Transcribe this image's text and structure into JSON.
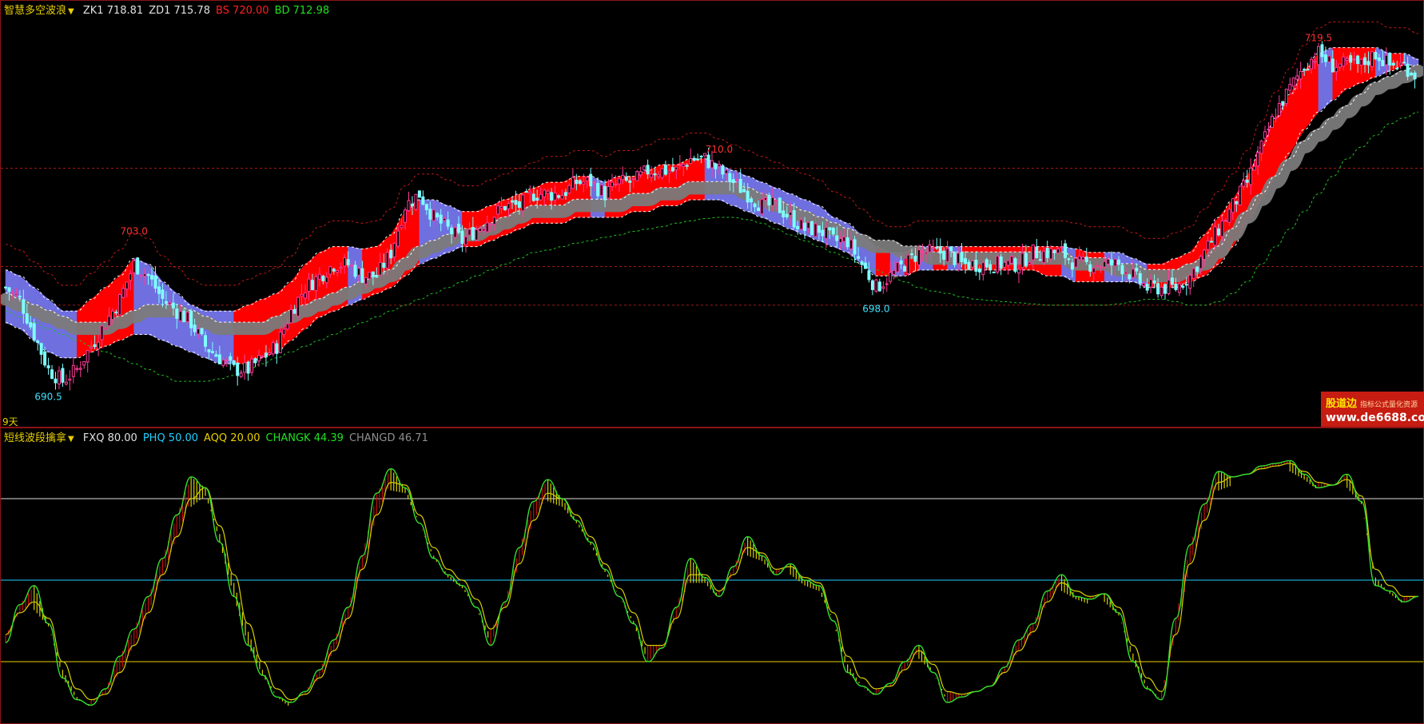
{
  "main_header": {
    "name": "智慧多空波浪",
    "items": [
      {
        "label": "ZK1 718.81",
        "color": "#e0e0e0"
      },
      {
        "label": "ZD1 715.78",
        "color": "#e0e0e0"
      },
      {
        "label": "BS 720.00",
        "color": "#ff2020"
      },
      {
        "label": "BD 712.98",
        "color": "#20e020"
      }
    ]
  },
  "sub_header": {
    "name": "短线波段擒拿",
    "items": [
      {
        "label": "FXQ 80.00",
        "color": "#e0e0e0"
      },
      {
        "label": "PHQ 50.00",
        "color": "#20d0ff"
      },
      {
        "label": "AQQ 20.00",
        "color": "#e8d000"
      },
      {
        "label": "CHANGK 44.39",
        "color": "#20e020"
      },
      {
        "label": "CHANGD 46.71",
        "color": "#909090"
      }
    ]
  },
  "duration_label": "9天",
  "watermark": {
    "line1": "股道边",
    "line1_small": "指标公式量化资源",
    "line2": "www.de6688.com"
  },
  "colors": {
    "up": "#ff3c9a",
    "down": "#7fffff",
    "band_up": "#ff0000",
    "band_down": "#6f6fe0",
    "center": "#7a7a7a"
  },
  "chart_data": [
    {
      "type": "line",
      "panel": "main",
      "ylim": [
        688,
        722
      ],
      "x_count": 100,
      "annotations": [
        {
          "text": "703.0",
          "x": 9,
          "y": 703.0,
          "color": "#ff3030",
          "pos": "above"
        },
        {
          "text": "690.5",
          "x": 3,
          "y": 690.5,
          "color": "#40e0ff",
          "pos": "below"
        },
        {
          "text": "710.0",
          "x": 50,
          "y": 710.0,
          "color": "#ff3030",
          "pos": "above"
        },
        {
          "text": "698.0",
          "x": 61,
          "y": 698.0,
          "color": "#40e0ff",
          "pos": "below"
        },
        {
          "text": "719.5",
          "x": 92,
          "y": 719.5,
          "color": "#ff3030",
          "pos": "above"
        }
      ],
      "h_levels": [
        709.2,
        700.8,
        697.5
      ],
      "series": [
        {
          "role": "price",
          "values": [
            699,
            698,
            695,
            692,
            691,
            692,
            694,
            696,
            698,
            701,
            700,
            698,
            697,
            696,
            694,
            693,
            692,
            692,
            693,
            694,
            697,
            699,
            700,
            701,
            701,
            700,
            700,
            702,
            706,
            707,
            705,
            704,
            703,
            704,
            705,
            706,
            706,
            707,
            707,
            707,
            708,
            708,
            707,
            708,
            708,
            709,
            709,
            709,
            710,
            710,
            709,
            708,
            707,
            706,
            706,
            705,
            704,
            704,
            703,
            703,
            701,
            699,
            700,
            701,
            702,
            702,
            702,
            701,
            701,
            701,
            701,
            701,
            702,
            702,
            702,
            701,
            701,
            701,
            701,
            700,
            699,
            699,
            699,
            700,
            702,
            704,
            706,
            708,
            711,
            714,
            716,
            718,
            719,
            718,
            718,
            718,
            719,
            718,
            718,
            717
          ]
        },
        {
          "role": "upper",
          "values": [
            700.5,
            700,
            699,
            698,
            697,
            697,
            698,
            699,
            700,
            701.5,
            701,
            699.5,
            698.5,
            697.5,
            697,
            697,
            697,
            697.5,
            698,
            698.5,
            699.5,
            701,
            702,
            702.5,
            702.5,
            702.3,
            702.5,
            703.5,
            705.5,
            706.5,
            706.5,
            706,
            705.5,
            705.5,
            706,
            706.5,
            707,
            707.5,
            708,
            708,
            708.5,
            708.5,
            708,
            708.5,
            708.5,
            709,
            709.5,
            709.5,
            710,
            710,
            709.5,
            709,
            708.5,
            708,
            707.5,
            707,
            706.5,
            706,
            705,
            704.5,
            703.5,
            702.5,
            702,
            702,
            702.5,
            702.5,
            702.5,
            702.5,
            702.5,
            702.5,
            702.5,
            702.5,
            702.5,
            702.5,
            702.5,
            702.3,
            702,
            702,
            702,
            701.5,
            701,
            701,
            701.5,
            702,
            703.5,
            705,
            706.5,
            708.5,
            711,
            713.5,
            715.5,
            717.5,
            719,
            719.5,
            719.5,
            719.5,
            719.5,
            719,
            719,
            718.5
          ]
        },
        {
          "role": "center",
          "values": [
            698,
            697.5,
            697,
            696.5,
            696,
            695.5,
            695.5,
            695.5,
            696,
            696.5,
            697,
            697,
            697,
            696.5,
            696,
            695.5,
            695.5,
            695.5,
            695.5,
            696,
            696.5,
            697,
            697.5,
            698,
            698.5,
            699,
            699.5,
            700,
            701,
            702,
            702.5,
            703,
            703.5,
            703.5,
            704,
            704.5,
            705,
            705.5,
            705.5,
            705.5,
            706,
            706,
            706,
            706,
            706.5,
            706.5,
            707,
            707,
            707.5,
            707.5,
            707.5,
            707.5,
            707,
            706.5,
            706,
            705.5,
            705,
            704.5,
            704,
            703.5,
            703,
            702.5,
            702.5,
            702,
            702,
            701.5,
            701.5,
            701.5,
            701.5,
            701.5,
            701.5,
            701.5,
            701.5,
            701.5,
            701.5,
            701,
            701,
            701,
            700.5,
            700.5,
            700,
            700,
            700,
            700.5,
            701,
            702,
            703.5,
            705,
            706.5,
            708,
            709.5,
            711,
            712,
            713,
            714,
            715,
            716,
            716.5,
            717,
            717.5
          ]
        },
        {
          "role": "lower",
          "values": [
            696,
            695.5,
            694.5,
            693.5,
            693,
            693,
            693.5,
            694,
            694.5,
            695,
            695,
            694.5,
            694,
            693.5,
            693,
            692.5,
            692.5,
            692.5,
            693,
            693.5,
            694.5,
            695.5,
            696.5,
            697,
            697.5,
            698,
            698.5,
            699,
            700,
            701,
            701.5,
            702,
            702.5,
            702.5,
            703,
            703.5,
            704,
            704.5,
            704.5,
            704.5,
            705,
            705,
            705,
            705,
            705.5,
            705.5,
            706,
            706,
            706.5,
            706.5,
            706.5,
            706,
            705.5,
            705,
            704.5,
            704,
            703.5,
            703,
            702.5,
            702,
            701,
            700,
            700,
            700,
            700.5,
            700.5,
            700.5,
            700.5,
            700.5,
            700.5,
            700.5,
            700.5,
            700.5,
            700,
            700,
            699.5,
            699.5,
            699.5,
            699.5,
            699.5,
            699,
            699,
            699,
            699.5,
            700,
            701,
            702.5,
            704.5,
            706.5,
            708.5,
            710.5,
            712.5,
            714,
            715,
            716,
            716.5,
            717,
            717.5,
            718,
            718
          ]
        },
        {
          "role": "support",
          "values": [
            697,
            696.5,
            696,
            695.5,
            695,
            694.5,
            694,
            693.5,
            693,
            692.5,
            692,
            691.5,
            691,
            691,
            691,
            691.2,
            691.5,
            692,
            692.5,
            693,
            693.5,
            694,
            694.5,
            695,
            695.5,
            696,
            696.5,
            697,
            697.5,
            698,
            698.5,
            699,
            699.5,
            700,
            700.5,
            701,
            701.5,
            702,
            702.2,
            702.5,
            702.8,
            703,
            703.3,
            703.5,
            703.8,
            704,
            704.2,
            704.5,
            704.7,
            704.9,
            705,
            705,
            704.8,
            704.5,
            704,
            703.5,
            703,
            702.5,
            702,
            701.5,
            701,
            700.5,
            700,
            699.5,
            699,
            698.7,
            698.5,
            698.2,
            698,
            697.9,
            697.8,
            697.7,
            697.6,
            697.5,
            697.5,
            697.5,
            697.5,
            697.5,
            697.6,
            697.8,
            698,
            698,
            697.8,
            697.5,
            697.5,
            697.8,
            698.5,
            699.5,
            701,
            702.5,
            704,
            705.5,
            707,
            708.5,
            710,
            711,
            712,
            713,
            713.5,
            714
          ]
        }
      ]
    },
    {
      "type": "line",
      "panel": "sub",
      "ylim": [
        0,
        100
      ],
      "h_levels": [
        {
          "value": 80,
          "color": "#e0e0e0"
        },
        {
          "value": 50,
          "color": "#20d0ff"
        },
        {
          "value": 20,
          "color": "#e8d000"
        }
      ],
      "series": [
        {
          "name": "CHANGK",
          "role": "fast",
          "values": [
            27,
            41,
            48,
            34,
            14,
            6,
            4,
            10,
            22,
            32,
            44,
            58,
            74,
            88,
            84,
            64,
            44,
            26,
            15,
            7,
            5,
            9,
            17,
            28,
            40,
            59,
            82,
            91,
            84,
            71,
            58,
            52,
            48,
            40,
            26,
            42,
            62,
            79,
            87,
            80,
            72,
            64,
            54,
            44,
            34,
            20,
            25,
            40,
            58,
            51,
            44,
            55,
            66,
            59,
            52,
            56,
            50,
            48,
            35,
            16,
            11,
            8,
            12,
            20,
            26,
            16,
            5,
            7,
            9,
            11,
            18,
            28,
            34,
            46,
            52,
            44,
            43,
            45,
            38,
            20,
            10,
            6,
            36,
            63,
            78,
            90,
            88,
            89,
            92,
            93,
            94,
            89,
            84,
            85,
            89,
            79,
            48,
            46,
            42,
            44
          ]
        },
        {
          "name": "CHANGD",
          "role": "slow",
          "values": [
            30,
            38,
            42,
            36,
            20,
            10,
            6,
            8,
            16,
            26,
            38,
            52,
            66,
            80,
            84,
            70,
            52,
            34,
            20,
            10,
            6,
            8,
            14,
            24,
            36,
            54,
            74,
            86,
            85,
            74,
            62,
            54,
            50,
            43,
            32,
            40,
            56,
            72,
            82,
            80,
            74,
            66,
            56,
            47,
            38,
            26,
            26,
            36,
            52,
            52,
            46,
            52,
            62,
            60,
            54,
            55,
            51,
            49,
            38,
            22,
            14,
            10,
            11,
            17,
            24,
            19,
            9,
            8,
            9,
            11,
            16,
            24,
            31,
            42,
            49,
            46,
            44,
            45,
            40,
            26,
            14,
            9,
            30,
            56,
            72,
            86,
            88,
            89,
            91,
            92,
            93,
            90,
            86,
            85,
            87,
            81,
            54,
            48,
            44,
            44
          ]
        }
      ]
    }
  ]
}
